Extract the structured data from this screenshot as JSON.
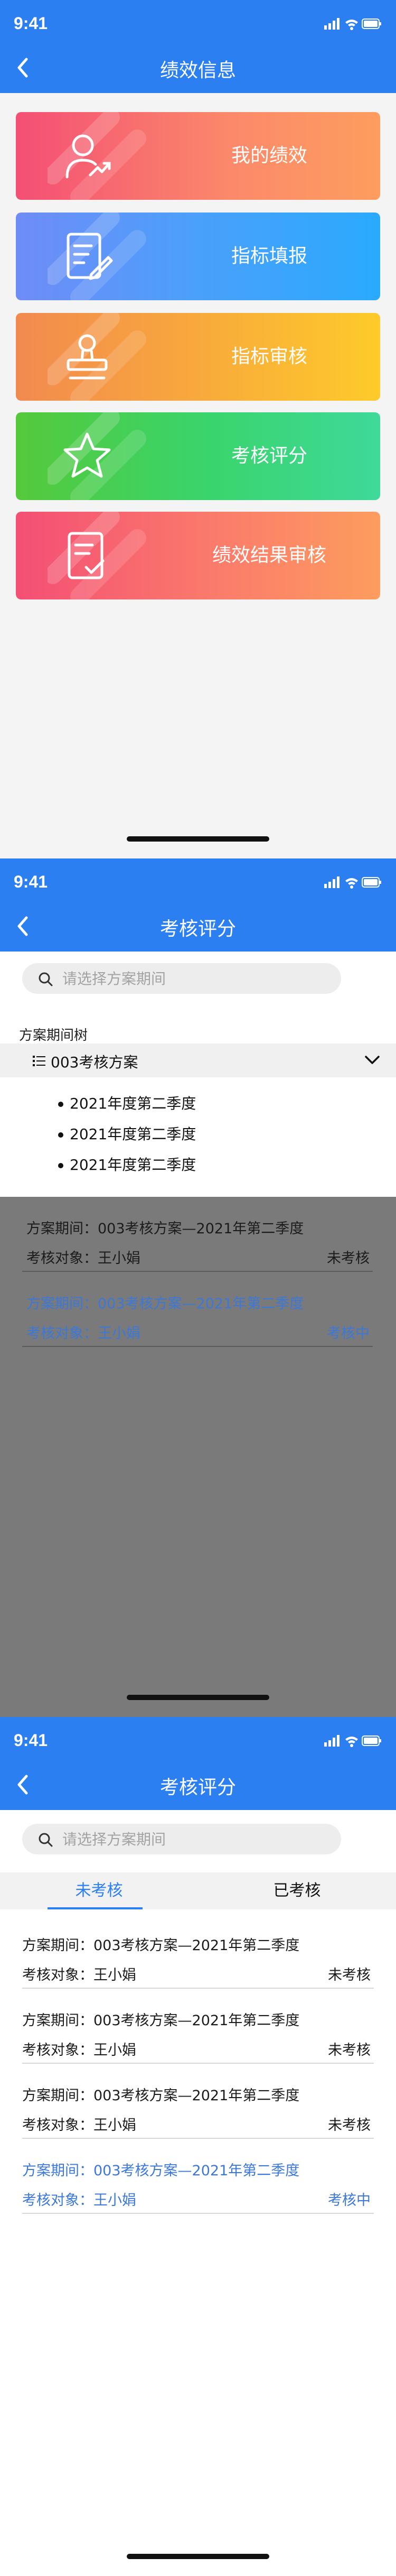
{
  "status_bar": {
    "time": "9:41"
  },
  "screen1": {
    "title": "绩效信息",
    "cards": [
      {
        "label": "我的绩效",
        "icon": "user-growth-icon"
      },
      {
        "label": "指标填报",
        "icon": "edit-document-icon"
      },
      {
        "label": "指标审核",
        "icon": "stamp-icon"
      },
      {
        "label": "考核评分",
        "icon": "star-icon"
      },
      {
        "label": "绩效结果审核",
        "icon": "checklist-document-icon"
      }
    ]
  },
  "screen2": {
    "title": "考核评分",
    "search_placeholder": "请选择方案期间",
    "tree_title": "方案期间树",
    "tree_root": "003考核方案",
    "tree_items": [
      "2021年度第二季度",
      "2021年度第二季度",
      "2021年度第二季度"
    ],
    "rows": [
      {
        "period": "方案期间：003考核方案—2021年第二季度",
        "target": "考核对象：王小娟",
        "status": "未考核"
      },
      {
        "period": "方案期间：003考核方案—2021年第二季度",
        "target": "考核对象：王小娟",
        "status": "考核中"
      }
    ]
  },
  "screen3": {
    "title": "考核评分",
    "search_placeholder": "请选择方案期间",
    "tabs": [
      "未考核",
      "已考核"
    ],
    "rows": [
      {
        "period": "方案期间：003考核方案—2021年第二季度",
        "target": "考核对象：王小娟",
        "status": "未考核"
      },
      {
        "period": "方案期间：003考核方案—2021年第二季度",
        "target": "考核对象：王小娟",
        "status": "未考核"
      },
      {
        "period": "方案期间：003考核方案—2021年第二季度",
        "target": "考核对象：王小娟",
        "status": "未考核"
      },
      {
        "period": "方案期间：003考核方案—2021年第二季度",
        "target": "考核对象：王小娟",
        "status": "考核中"
      }
    ]
  },
  "colors": {
    "primary": "#2b7ff0",
    "in_progress": "#3b78d8",
    "overlay": "#7a7a7a"
  }
}
